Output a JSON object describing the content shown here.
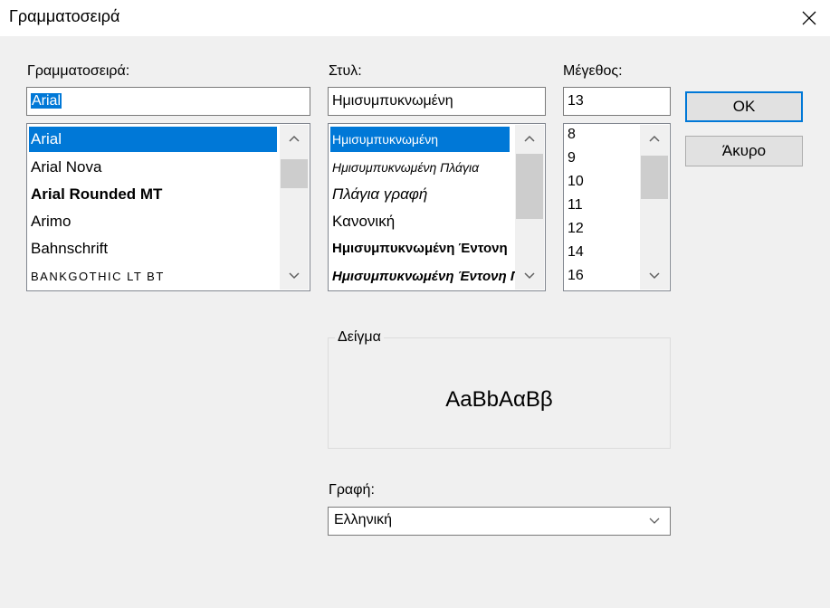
{
  "window": {
    "title": "Γραμματοσειρά"
  },
  "font": {
    "label": "Γραμματοσειρά:",
    "input_value": "Arial",
    "items": [
      "Arial",
      "Arial Nova",
      "Arial Rounded MT",
      "Arimo",
      "Bahnschrift",
      "BANKGOTHIC LT BT"
    ],
    "selected_index": 0
  },
  "style": {
    "label": "Στυλ:",
    "input_value": "Ημισυμπυκνωμένη",
    "items": [
      "Ημισυμπυκνωμένη",
      "Ημισυμπυκνωμένη Πλάγια",
      "Πλάγια γραφή",
      "Κανονική",
      "Ημισυμπυκνωμένη Έντονη",
      "Ημισυμπυκνωμένη Έντονη Πλάγια"
    ],
    "selected_index": 0
  },
  "size": {
    "label": "Μέγεθος:",
    "input_value": "13",
    "items": [
      "8",
      "9",
      "10",
      "11",
      "12",
      "14",
      "16"
    ]
  },
  "buttons": {
    "ok": "OK",
    "cancel": "Άκυρο"
  },
  "sample": {
    "legend": "Δείγμα",
    "text": "AaBbΑαΒβ"
  },
  "script": {
    "label": "Γραφή:",
    "value": "Ελληνική"
  },
  "colors": {
    "selection": "#0078d7",
    "dialog_bg": "#f0f0f0",
    "default_button_border": "#0078d7"
  }
}
